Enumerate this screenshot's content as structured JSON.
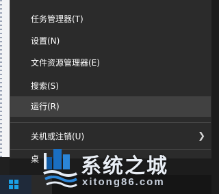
{
  "menu": {
    "items": [
      {
        "label": "任务管理器(T)"
      },
      {
        "label": "设置(N)"
      },
      {
        "label": "文件资源管理器(E)"
      },
      {
        "label": "搜索(S)"
      },
      {
        "label": "运行(R)"
      },
      {
        "label": "关机或注销(U)",
        "submenu_icon": "chevron-right-icon"
      }
    ],
    "partial_item_text": "桌",
    "highlighted_item": "运行(R)"
  },
  "taskbar": {
    "start_icon": "windows-logo-icon"
  },
  "watermark": {
    "title": "系统之城",
    "domain": "xitong86.com",
    "logo_icon": "city-logo-icon"
  },
  "colors": {
    "menu_background": "#2b2b2b",
    "menu_highlight": "#414141",
    "menu_text": "#ffffff",
    "windows_blue": "#1aa0e6"
  }
}
